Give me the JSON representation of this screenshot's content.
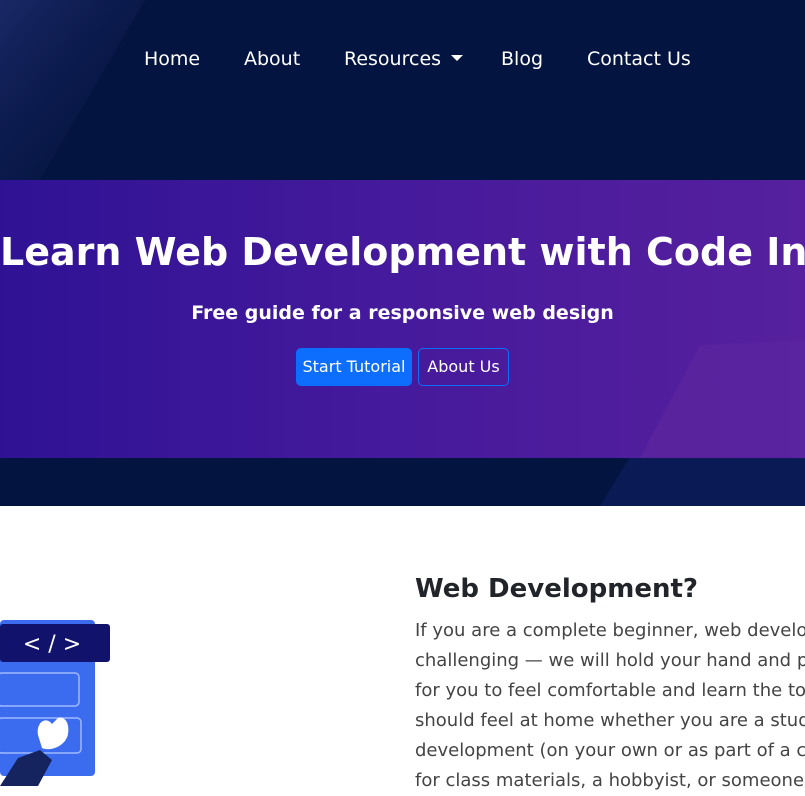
{
  "nav": {
    "items": [
      {
        "label": "Home"
      },
      {
        "label": "About"
      },
      {
        "label": "Resources"
      },
      {
        "label": "Blog"
      },
      {
        "label": "Contact Us"
      }
    ]
  },
  "hero": {
    "title": "Learn Web Development with Code Info",
    "subtitle": "Free guide for a responsive web design",
    "primary_button": "Start Tutorial",
    "secondary_button": "About Us"
  },
  "content": {
    "heading": "Web Development?",
    "lines": [
      "If you are a complete beginner, web developm",
      "challenging — we will hold your hand and prov",
      "for you to feel comfortable and learn the topic",
      "should feel at home whether you are a student",
      "development (on your own or as part of a clas",
      "for class materials, a hobbyist, or someone wh"
    ],
    "illustration_code_glyph": "< / >"
  },
  "colors": {
    "header_bg": "#041440",
    "band_start": "#2f1294",
    "band_end": "#56209e",
    "button_primary": "#0d6efd"
  },
  "icons": {
    "dropdown": "caret-down-icon",
    "illustration": "code-window-illustration"
  }
}
